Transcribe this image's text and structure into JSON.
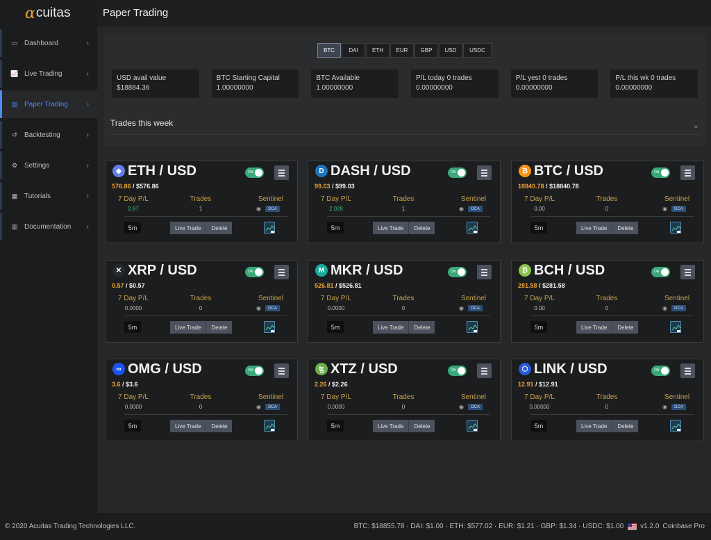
{
  "app": {
    "logo_alpha": "α",
    "logo_rest": "cuitas",
    "page_title": "Paper Trading"
  },
  "sidebar": {
    "items": [
      {
        "label": "Dashboard",
        "icon": "monitor-icon"
      },
      {
        "label": "Live Trading",
        "icon": "chart-line-icon"
      },
      {
        "label": "Paper Trading",
        "icon": "document-icon",
        "active": true
      },
      {
        "label": "Backtesting",
        "icon": "undo-icon"
      },
      {
        "label": "Settings",
        "icon": "gear-icon"
      },
      {
        "label": "Tutorials",
        "icon": "map-icon"
      },
      {
        "label": "Documentation",
        "icon": "book-icon"
      }
    ]
  },
  "currency_tabs": {
    "items": [
      "BTC",
      "DAI",
      "ETH",
      "EUR",
      "GBP",
      "USD",
      "USDC"
    ],
    "active": "BTC"
  },
  "stats": [
    {
      "label": "USD avail value",
      "value": "$18884.36"
    },
    {
      "label": "BTC Starting Capital",
      "value": "1.00000000"
    },
    {
      "label": "BTC Available",
      "value": "1.00000000"
    },
    {
      "label": "P/L today 0 trades",
      "value": "0.00000000"
    },
    {
      "label": "P/L yest 0 trades",
      "value": "0.00000000"
    },
    {
      "label": "P/L this wk 0 trades",
      "value": "0.00000000"
    }
  ],
  "trades_week_label": "Trades this week",
  "card_labels": {
    "pl": "7 Day P/L",
    "trades": "Trades",
    "sentinel": "Sentinel",
    "dca": "DCA",
    "toggle_on": "ON",
    "interval": "5m",
    "live_trade": "Live Trade",
    "delete": "Delete"
  },
  "cards": [
    {
      "pair": "ETH / USD",
      "price_gold": "576.86",
      "price_white": "$576.86",
      "pl": "0.87",
      "pl_color": "green",
      "trades": "1",
      "icon_color": "#627eea",
      "icon": "ethereum-icon",
      "glyph": "◆"
    },
    {
      "pair": "DASH / USD",
      "price_gold": "99.03",
      "price_white": "$99.03",
      "pl": "2.028",
      "pl_color": "green",
      "trades": "1",
      "icon_color": "#1c75bc",
      "icon": "dash-icon",
      "glyph": "D"
    },
    {
      "pair": "BTC / USD",
      "price_gold": "18840.78",
      "price_white": "$18840.78",
      "pl": "0.00",
      "pl_color": "grey",
      "trades": "0",
      "icon_color": "#f7931a",
      "icon": "bitcoin-icon",
      "glyph": "₿"
    },
    {
      "pair": "XRP / USD",
      "price_gold": "0.57",
      "price_white": "$0.57",
      "pl": "0.0000",
      "pl_color": "grey",
      "trades": "0",
      "icon_color": "#23292f",
      "icon": "xrp-icon",
      "glyph": "✕"
    },
    {
      "pair": "MKR / USD",
      "price_gold": "526.81",
      "price_white": "$526.81",
      "pl": "0.0000",
      "pl_color": "grey",
      "trades": "0",
      "icon_color": "#1aab9b",
      "icon": "maker-icon",
      "glyph": "M"
    },
    {
      "pair": "BCH / USD",
      "price_gold": "281.58",
      "price_white": "$281.58",
      "pl": "0.00",
      "pl_color": "grey",
      "trades": "0",
      "icon_color": "#8dc351",
      "icon": "bitcoin-cash-icon",
      "glyph": "₿"
    },
    {
      "pair": "OMG / USD",
      "price_gold": "3.6",
      "price_white": "$3.6",
      "pl": "0.0000",
      "pl_color": "grey",
      "trades": "0",
      "icon_color": "#1a53f0",
      "icon": "omg-icon",
      "glyph": "∞"
    },
    {
      "pair": "XTZ / USD",
      "price_gold": "2.26",
      "price_white": "$2.26",
      "pl": "0.0000",
      "pl_color": "grey",
      "trades": "0",
      "icon_color": "#6ab04c",
      "icon": "tezos-icon",
      "glyph": "ꜩ"
    },
    {
      "pair": "LINK / USD",
      "price_gold": "12.91",
      "price_white": "$12.91",
      "pl": "0.00000",
      "pl_color": "grey",
      "trades": "0",
      "icon_color": "#2a5ada",
      "icon": "chainlink-icon",
      "glyph": "⬡"
    }
  ],
  "footer": {
    "copyright": "© 2020 Acuitas Trading Technologies LLC.",
    "prices": "BTC: $18855.78  ·  DAI: $1.00  ·  ETH: $577.02  ·  EUR: $1.21  ·  GBP: $1.34  ·  USDC: $1.00",
    "version": "v1.2.0",
    "exchange": "Coinbase Pro"
  },
  "colors": {
    "accent": "#4a8bf5",
    "gold": "#e8a13a",
    "green": "#38b47f",
    "toggle": "#3aa97a"
  }
}
